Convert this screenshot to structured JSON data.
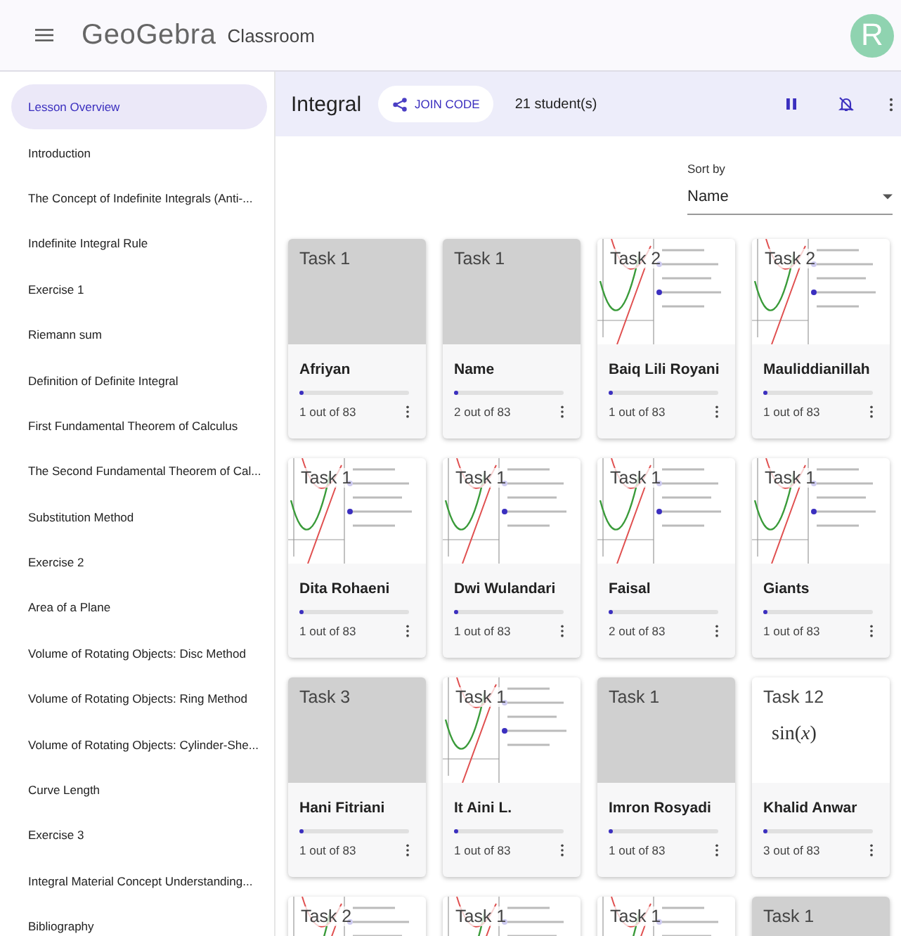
{
  "header": {
    "logo": "GeoGebra",
    "product": "Classroom",
    "avatar": "R"
  },
  "sidebar": {
    "items": [
      {
        "label": "Lesson Overview",
        "selected": true
      },
      {
        "label": "Introduction",
        "selected": false
      },
      {
        "label": "The Concept of Indefinite Integrals (Anti-...",
        "selected": false
      },
      {
        "label": "Indefinite Integral Rule",
        "selected": false
      },
      {
        "label": "Exercise 1",
        "selected": false
      },
      {
        "label": "Riemann sum",
        "selected": false
      },
      {
        "label": "Definition of Definite Integral",
        "selected": false
      },
      {
        "label": "First Fundamental Theorem of Calculus",
        "selected": false
      },
      {
        "label": "The Second Fundamental Theorem of Cal...",
        "selected": false
      },
      {
        "label": "Substitution Method",
        "selected": false
      },
      {
        "label": "Exercise 2",
        "selected": false
      },
      {
        "label": "Area of a Plane",
        "selected": false
      },
      {
        "label": "Volume of Rotating Objects: Disc Method",
        "selected": false
      },
      {
        "label": "Volume of Rotating Objects: Ring Method",
        "selected": false
      },
      {
        "label": "Volume of Rotating Objects: Cylinder-She...",
        "selected": false
      },
      {
        "label": "Curve Length",
        "selected": false
      },
      {
        "label": "Exercise 3",
        "selected": false
      },
      {
        "label": "Integral Material Concept Understanding...",
        "selected": false
      },
      {
        "label": "Bibliography",
        "selected": false
      }
    ]
  },
  "toolbar": {
    "title": "Integral",
    "join_code": "JOIN CODE",
    "students": "21 student(s)"
  },
  "sort": {
    "label": "Sort by",
    "value": "Name"
  },
  "cards": [
    {
      "task": "Task 1",
      "kind": "blank",
      "name": "Afriyan",
      "level": 0.012,
      "progress": "1 out of 83"
    },
    {
      "task": "Task 1",
      "kind": "blank",
      "name": "Name",
      "level": 0.024,
      "progress": "2 out of 83"
    },
    {
      "task": "Task 2",
      "kind": "graph",
      "name": "Baiq Lili Royani",
      "level": 0.012,
      "progress": "1 out of 83"
    },
    {
      "task": "Task 2",
      "kind": "graph",
      "name": "Mauliddianillah",
      "level": 0.012,
      "progress": "1 out of 83"
    },
    {
      "task": "Task 1",
      "kind": "graph",
      "name": "Dita Rohaeni",
      "level": 0.012,
      "progress": "1 out of 83"
    },
    {
      "task": "Task 1",
      "kind": "graph",
      "name": "Dwi Wulandari",
      "level": 0.012,
      "progress": "1 out of 83"
    },
    {
      "task": "Task 1",
      "kind": "graph",
      "name": "Faisal",
      "level": 0.024,
      "progress": "2 out of 83"
    },
    {
      "task": "Task 1",
      "kind": "graph",
      "name": "Giants",
      "level": 0.012,
      "progress": "1 out of 83"
    },
    {
      "task": "Task 3",
      "kind": "blank",
      "name": "Hani Fitriani",
      "level": 0.012,
      "progress": "1 out of 83"
    },
    {
      "task": "Task 1",
      "kind": "graph",
      "name": "It Aini L.",
      "level": 0.012,
      "progress": "1 out of 83"
    },
    {
      "task": "Task 1",
      "kind": "blank",
      "name": "Imron Rosyadi",
      "level": 0.012,
      "progress": "1 out of 83"
    },
    {
      "task": "Task 12",
      "kind": "formula",
      "formula": "sin(*x*)",
      "name": "Khalid Anwar",
      "level": 0.036,
      "progress": "3 out of 83"
    },
    {
      "task": "Task 2",
      "kind": "graph"
    },
    {
      "task": "Task 1",
      "kind": "graph"
    },
    {
      "task": "Task 1",
      "kind": "graph"
    },
    {
      "task": "Task 1",
      "kind": "blank"
    }
  ]
}
